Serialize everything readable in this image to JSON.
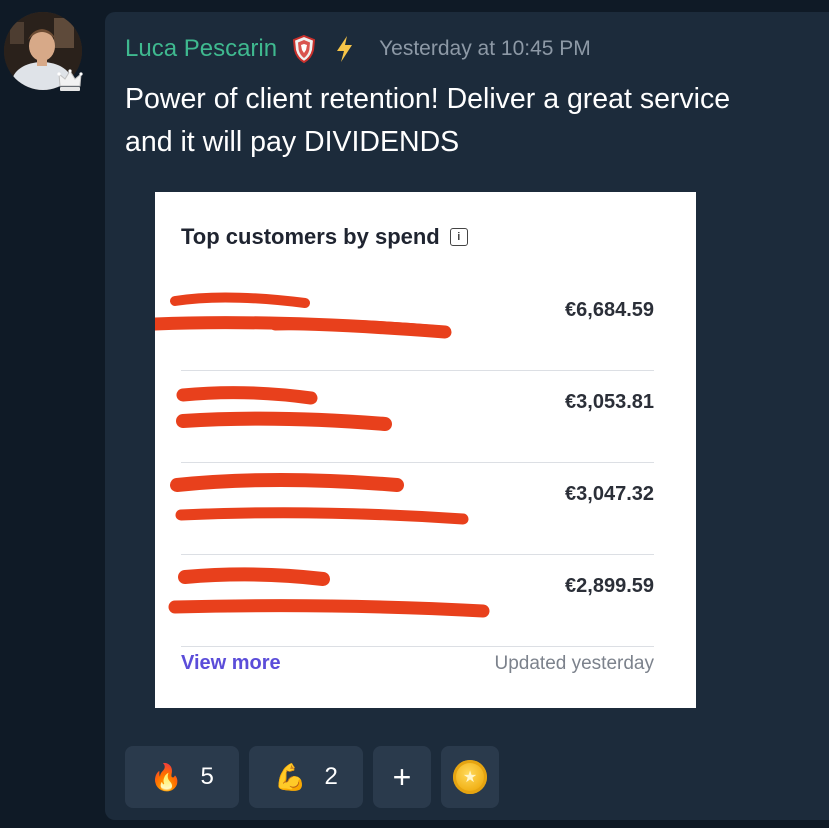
{
  "message": {
    "author": "Luca Pescarin",
    "timestamp": "Yesterday at 10:45 PM",
    "text": "Power of client retention! Deliver a great service and it will pay DIVIDENDS",
    "badges": [
      "shield-icon",
      "lightning-bolt-icon"
    ]
  },
  "attachment": {
    "title": "Top customers by spend",
    "customers": [
      {
        "name": "[redacted]",
        "email": "[redacted]",
        "amount": "€6,684.59"
      },
      {
        "name": "[redacted]",
        "email": "[redacted]",
        "amount": "€3,053.81"
      },
      {
        "name": "[redacted]",
        "email": "[redacted]",
        "amount": "€3,047.32"
      },
      {
        "name": "[redacted]",
        "email": "[redacted]",
        "amount": "€2,899.59"
      }
    ],
    "view_more": "View more",
    "updated": "Updated yesterday"
  },
  "reactions": [
    {
      "emoji": "🔥",
      "icon": "fire-icon",
      "count": "5"
    },
    {
      "emoji": "💪",
      "icon": "flexed-biceps-icon",
      "count": "2"
    }
  ],
  "add_reaction": "+",
  "colors": {
    "background": "#0f1a26",
    "card": "#1c2b3b",
    "username": "#3fb98f",
    "timestamp": "#8d99a6",
    "link": "#5b4dd9",
    "redaction": "#e8401c"
  }
}
